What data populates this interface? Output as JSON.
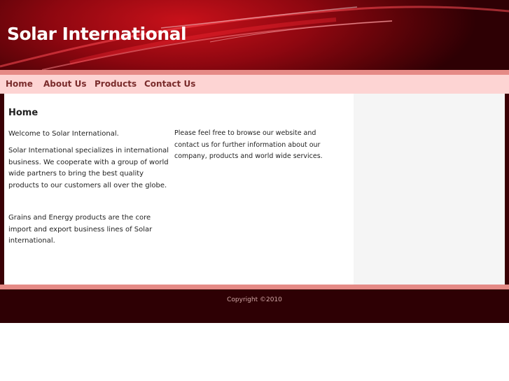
{
  "site": {
    "title": "Solar International"
  },
  "nav": {
    "items": [
      {
        "label": "Home"
      },
      {
        "label": "About Us"
      },
      {
        "label": "Products"
      },
      {
        "label": "Contact Us"
      }
    ]
  },
  "main": {
    "heading": "Home",
    "welcome": "Welcome to Solar International.",
    "intro": "Solar International  specializes in international business. We cooperate with a group of world wide partners to bring the best quality products to our customers all over the globe.",
    "core": "Grains and Energy products are the core import and export business lines of Solar international.",
    "browse": "Please feel free to browse our website and contact us for further information about our company,  products and world wide services."
  },
  "footer": {
    "copyright": "Copyright ©2010"
  },
  "colors": {
    "header_red": "#c8111a",
    "dark_maroon": "#2e0004",
    "nav_pink": "#fdd4d3",
    "stripe_pink": "#e58a86",
    "nav_text": "#7a2c2c"
  }
}
